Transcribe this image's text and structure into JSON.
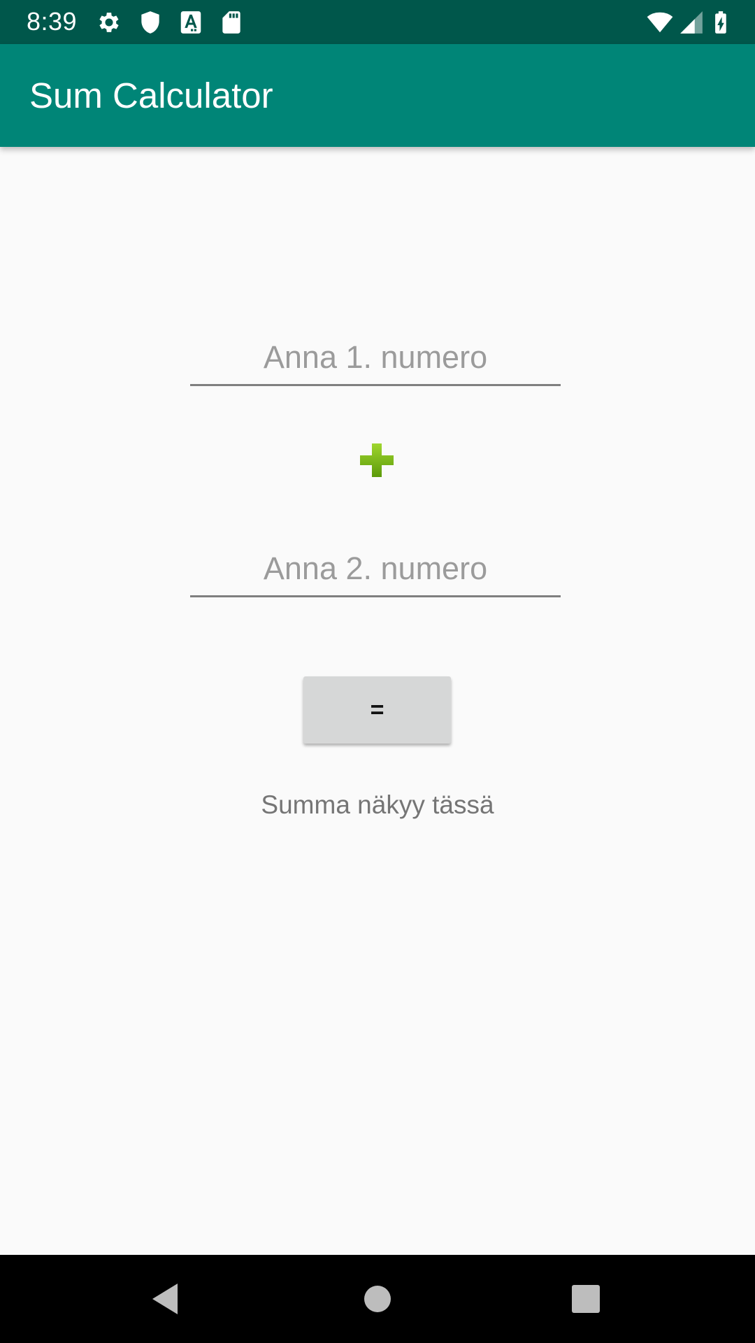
{
  "status_bar": {
    "time": "8:39",
    "icons": [
      "gear-icon",
      "shield-icon",
      "a-text-icon",
      "sd-card-icon",
      "wifi-icon",
      "signal-icon",
      "battery-charging-icon"
    ]
  },
  "app_bar": {
    "title": "Sum Calculator"
  },
  "form": {
    "first_number": {
      "value": "",
      "placeholder": "Anna 1. numero"
    },
    "operator_icon": "plus-icon",
    "second_number": {
      "value": "",
      "placeholder": "Anna 2. numero"
    },
    "equals_label": "=",
    "result_text": "Summa näkyy tässä"
  },
  "nav_bar": {
    "icons": [
      "back-icon",
      "home-icon",
      "recents-icon"
    ]
  },
  "colors": {
    "status_bar": "#00574b",
    "app_bar": "#008577",
    "background": "#fafafa",
    "plus_green": "#7cb518",
    "button": "#d6d7d7"
  }
}
